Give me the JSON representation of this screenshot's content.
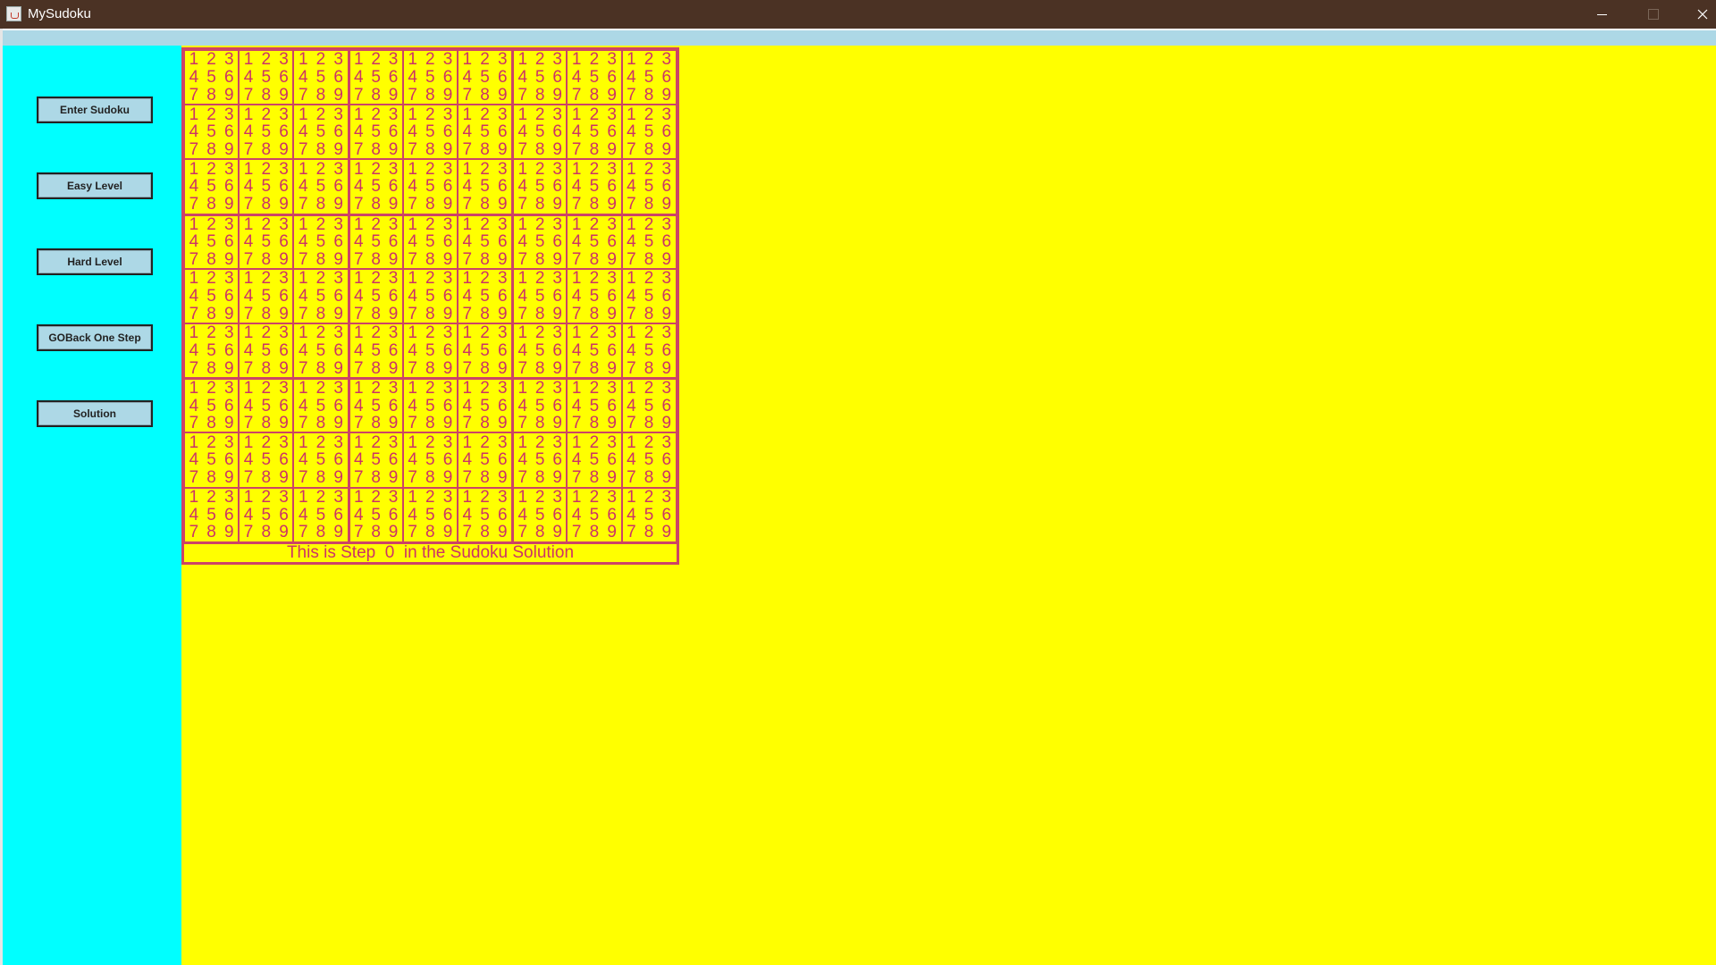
{
  "window": {
    "title": "MySudoku",
    "icon": "java-cup-icon"
  },
  "sidebar": {
    "buttons": [
      {
        "label": "Enter Sudoku"
      },
      {
        "label": "Easy Level"
      },
      {
        "label": "Hard Level"
      },
      {
        "label": "GOBack One Step"
      },
      {
        "label": "Solution"
      }
    ]
  },
  "board": {
    "size": 9,
    "candidates": [
      "1",
      "2",
      "3",
      "4",
      "5",
      "6",
      "7",
      "8",
      "9"
    ],
    "status": "This is Step  0  in the Sudoku Solution"
  },
  "colors": {
    "title_bar": "#4b3224",
    "menu_bar": "#add8e6",
    "sidebar": "#00ffff",
    "board_background": "#ffff00",
    "grid_lines": "#cc4466",
    "digits": "#cc3366",
    "button": "#add8e6"
  }
}
